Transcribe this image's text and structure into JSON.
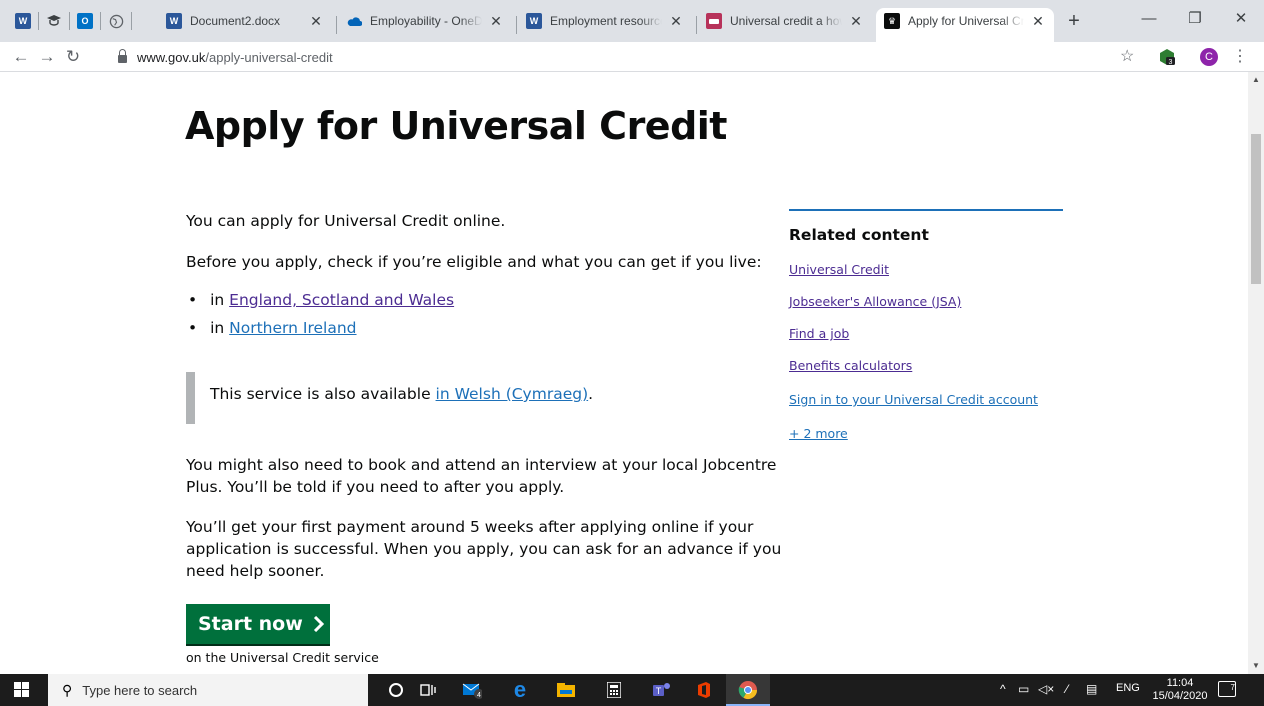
{
  "browser": {
    "tabs": [
      {
        "label": "Document2.docx",
        "icon": "word-icon"
      },
      {
        "label": "Employability - OneDrive",
        "icon": "onedrive-icon"
      },
      {
        "label": "Employment resource - U",
        "icon": "word-icon"
      },
      {
        "label": "Universal credit a how to",
        "icon": "stream-icon"
      },
      {
        "label": "Apply for Universal Credit",
        "icon": "govuk-icon",
        "active": true
      }
    ],
    "url_host": "www.gov.uk",
    "url_path": "/apply-universal-credit",
    "profile_initial": "C",
    "extension_badge": "3"
  },
  "page": {
    "title": "Apply for Universal Credit",
    "intro": "You can apply for Universal Credit online.",
    "check_text": "Before you apply, check if you’re eligible and what you can get if you live:",
    "bullets": [
      {
        "prefix": "in ",
        "link": "England, Scotland and Wales"
      },
      {
        "prefix": "in ",
        "link": "Northern Ireland"
      }
    ],
    "inset_prefix": "This service is also available ",
    "inset_link": "in Welsh (Cymraeg)",
    "inset_suffix": ".",
    "interview_line1": "You might also need to book and attend an interview at your local Jobcentre",
    "interview_line2": "Plus. You’ll be told if you need to after you apply.",
    "payment_line1": "You’ll get your first payment around 5 weeks after applying online if your",
    "payment_line2": "application is successful. When you apply, you can ask for an advance if you",
    "payment_line3": "need help sooner.",
    "start_label": "Start now",
    "start_sub": "on the Universal Credit service"
  },
  "related": {
    "title": "Related content",
    "links": [
      "Universal Credit",
      "Jobseeker's Allowance (JSA)",
      "Find a job",
      "Benefits calculators",
      "Sign in to your Universal Credit account",
      "+ 2 more"
    ]
  },
  "taskbar": {
    "search_placeholder": "Type here to search",
    "language": "ENG",
    "time": "11:04",
    "date": "15/04/2020",
    "notification_count": "7",
    "mail_badge": "4"
  },
  "colors": {
    "link_visited": "#4c2c92",
    "link": "#1d70b8",
    "start_button": "#00703c",
    "taskbar": "#1c1c1c"
  }
}
